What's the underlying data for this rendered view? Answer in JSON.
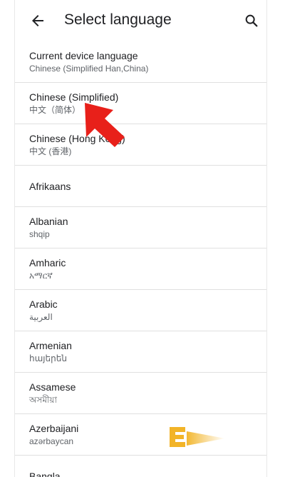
{
  "header": {
    "title": "Select language",
    "back_icon": "arrow-back-icon",
    "search_icon": "search-icon"
  },
  "languages": [
    {
      "name": "Current device language",
      "native": "Chinese (Simplified Han,China)"
    },
    {
      "name": "Chinese (Simplified)",
      "native": "中文（简体）"
    },
    {
      "name": "Chinese (Hong Kong)",
      "native": "中文 (香港)"
    },
    {
      "name": "Afrikaans",
      "native": ""
    },
    {
      "name": "Albanian",
      "native": "shqip"
    },
    {
      "name": "Amharic",
      "native": "አማርኛ"
    },
    {
      "name": "Arabic",
      "native": "العربية"
    },
    {
      "name": "Armenian",
      "native": "հայերեն"
    },
    {
      "name": "Assamese",
      "native": "অসমীয়া"
    },
    {
      "name": "Azerbaijani",
      "native": "azərbaycan"
    },
    {
      "name": "Bangla",
      "native": ""
    }
  ],
  "colors": {
    "annotation_arrow": "#e8201a",
    "divider": "#e0e0e0",
    "watermark": "#f2b428"
  }
}
